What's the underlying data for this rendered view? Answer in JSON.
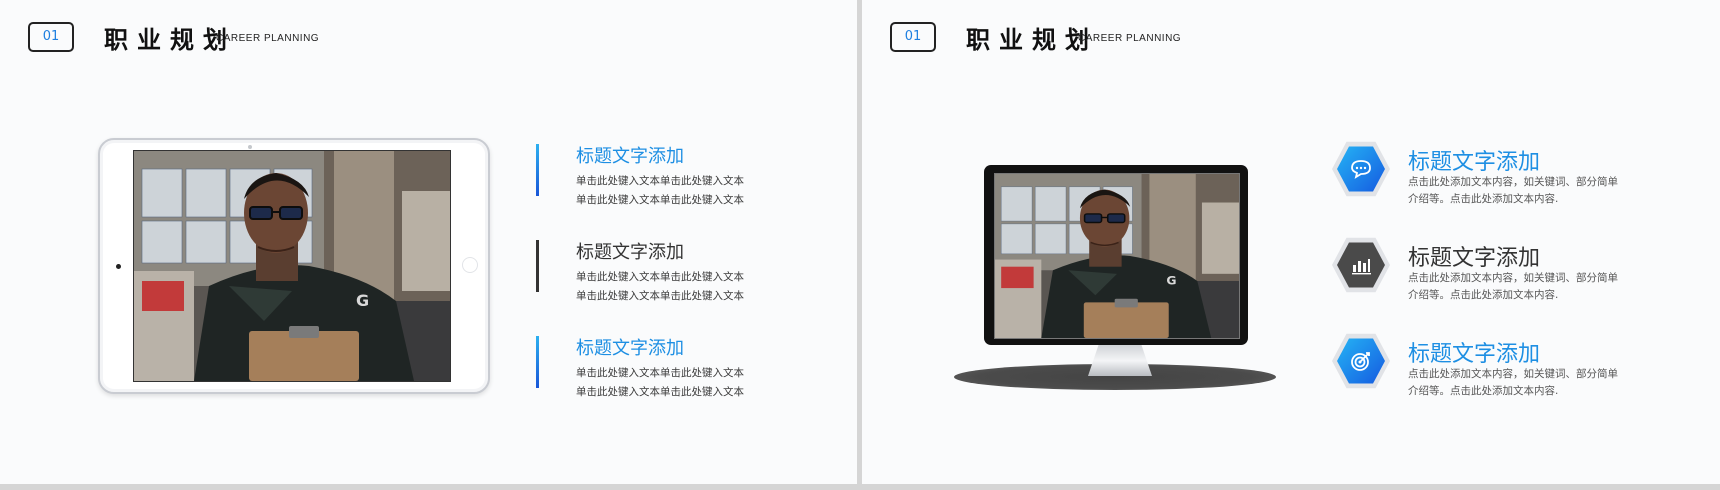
{
  "header": {
    "badge": "01",
    "title": "职业规划",
    "subtitle": "CAREER PLANNING"
  },
  "left_items": [
    {
      "title": "标题文字添加",
      "line1": "单击此处键入文本单击此处键入文本",
      "line2": "单击此处键入文本单击此处键入文本",
      "style": "blue"
    },
    {
      "title": "标题文字添加",
      "line1": "单击此处键入文本单击此处键入文本",
      "line2": "单击此处键入文本单击此处键入文本",
      "style": "dark"
    },
    {
      "title": "标题文字添加",
      "line1": "单击此处键入文本单击此处键入文本",
      "line2": "单击此处键入文本单击此处键入文本",
      "style": "blue"
    }
  ],
  "right_items": [
    {
      "title": "标题文字添加",
      "line1": "点击此处添加文本内容，如关键词、部分简单",
      "line2": "介绍等。点击此处添加文本内容.",
      "icon": "chat-bubble-icon",
      "style": "blue"
    },
    {
      "title": "标题文字添加",
      "line1": "点击此处添加文本内容，如关键词、部分简单",
      "line2": "介绍等。点击此处添加文本内容.",
      "icon": "bar-chart-icon",
      "style": "dark"
    },
    {
      "title": "标题文字添加",
      "line1": "点击此处添加文本内容，如关键词、部分简单",
      "line2": "介绍等。点击此处添加文本内容.",
      "icon": "target-icon",
      "style": "blue"
    }
  ],
  "photo": {
    "jersey_logo": "G"
  },
  "colors": {
    "accent_blue": "#1e8fe3",
    "dark": "#333333",
    "background": "#fafbfc"
  }
}
